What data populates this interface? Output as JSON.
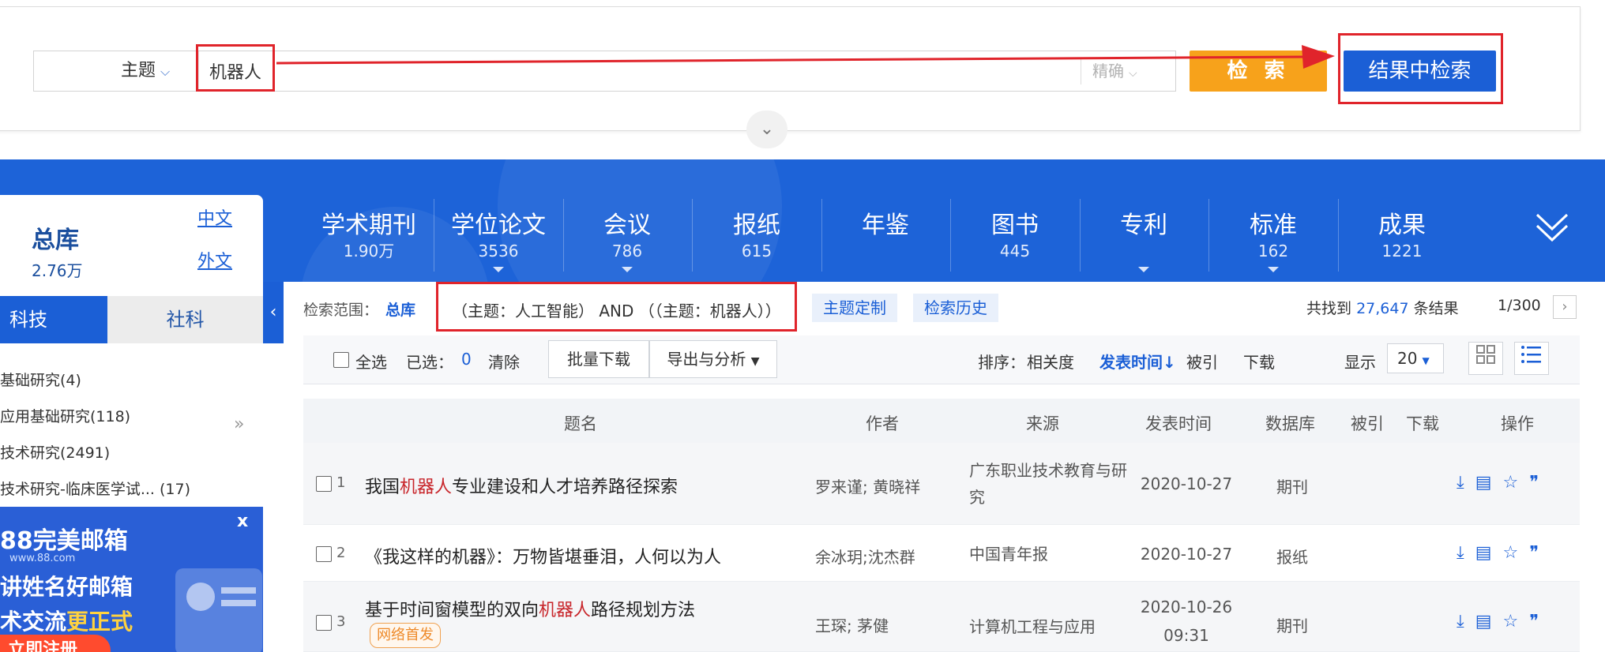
{
  "search": {
    "field": "主题",
    "query": "机器人",
    "match_mode": "精确",
    "search_label": "检 索",
    "refine_label": "结果中检索",
    "expand_icon": "double-chevron-down-icon"
  },
  "categories": [
    {
      "name": "学术期刊",
      "count": "1.90万",
      "caret": false
    },
    {
      "name": "学位论文",
      "count": "3536",
      "caret": true
    },
    {
      "name": "会议",
      "count": "786",
      "caret": true
    },
    {
      "name": "报纸",
      "count": "615",
      "caret": false
    },
    {
      "name": "年鉴",
      "count": "",
      "caret": false
    },
    {
      "name": "图书",
      "count": "445",
      "caret": false
    },
    {
      "name": "专利",
      "count": "",
      "caret": true
    },
    {
      "name": "标准",
      "count": "162",
      "caret": true
    },
    {
      "name": "成果",
      "count": "1221",
      "caret": false
    }
  ],
  "library": {
    "label": "总库",
    "count": "2.76万",
    "lang_chinese": "中文",
    "lang_foreign": "外文"
  },
  "sidebar": {
    "tabs": [
      "科技",
      "社科"
    ],
    "active_tab": "科技",
    "facets": [
      "基础研究(4)",
      "应用基础研究(118)",
      "技术研究(2491)",
      "技术研究-临床医学试... (17)"
    ],
    "ad": {
      "logo": "88完美邮箱",
      "url": "www.88.com",
      "line1": "讲姓名好邮箱",
      "line2_prefix": "术交流",
      "line2_highlight": "更正式",
      "register": "立即注册",
      "close": "x"
    }
  },
  "scope": {
    "label": "检索范围：",
    "value": "总库",
    "condition": "（主题：人工智能） AND （（主题：机器人））",
    "custom_topic": "主题定制",
    "history": "检索历史",
    "found_prefix": "共找到",
    "found_count": "27,647",
    "found_suffix": "条结果",
    "page": "1/300"
  },
  "toolbar": {
    "select_all": "全选",
    "selected_label": "已选：",
    "selected_count": "0",
    "clear": "清除",
    "batch_download": "批量下载",
    "export_analysis": "导出与分析",
    "sort_label": "排序：",
    "sort_relevance": "相关度",
    "sort_date": "发表时间↓",
    "sort_cited": "被引",
    "sort_downloads": "下载",
    "display_label": "显示",
    "page_size": "20"
  },
  "table": {
    "headers": {
      "title": "题名",
      "author": "作者",
      "source": "来源",
      "date": "发表时间",
      "database": "数据库",
      "cited": "被引",
      "downloads": "下载",
      "actions": "操作"
    },
    "rows": [
      {
        "index": "1",
        "title_pre": "我国",
        "title_kw": "机器人",
        "title_post": "专业建设和人才培养路径探索",
        "author": "罗来谨; 黄晓祥",
        "source": "广东职业技术教育与研究",
        "date": "2020-10-27",
        "time": "",
        "database": "期刊",
        "tag": ""
      },
      {
        "index": "2",
        "title_pre": "《我这样的机器》：万物皆堪垂泪，人何以为人",
        "title_kw": "",
        "title_post": "",
        "author": "余冰玥;沈杰群",
        "source": "中国青年报",
        "date": "2020-10-27",
        "time": "",
        "database": "报纸",
        "tag": ""
      },
      {
        "index": "3",
        "title_pre": "基于时间窗模型的双向",
        "title_kw": "机器人",
        "title_post": "路径规划方法",
        "author": "王琛; 茅健",
        "source": "计算机工程与应用",
        "date": "2020-10-26",
        "time": "09:31",
        "database": "期刊",
        "tag": "网络首发"
      }
    ],
    "action_icons": [
      "download-icon",
      "html-read-icon",
      "favorite-star-icon",
      "quote-icon"
    ]
  },
  "colors": {
    "primary": "#1b5fd6",
    "search_button": "#f7a21b",
    "annotation": "#e0242b",
    "keyword": "#c8262b"
  }
}
